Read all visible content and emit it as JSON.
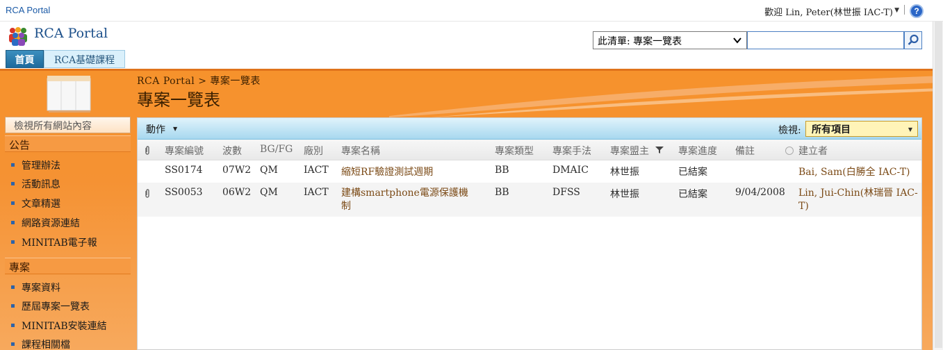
{
  "topbar": {
    "site_name": "RCA Portal",
    "welcome": "歡迎 Lin, Peter(林世振 IAC-T)",
    "help_icon": "help-icon"
  },
  "header": {
    "logo_text": "RCA Portal",
    "search_scope": "此清單: 專案一覽表",
    "search_placeholder": "",
    "tabs": [
      {
        "label": "首頁",
        "selected": true
      },
      {
        "label": "RCA基礎課程",
        "selected": false
      }
    ]
  },
  "page": {
    "breadcrumb": "RCA Portal > 專案一覽表",
    "title": "專案一覽表"
  },
  "leftnav": {
    "view_all": "檢視所有網站內容",
    "sections": [
      {
        "heading": "公告",
        "items": [
          "管理辦法",
          "活動訊息",
          "文章精選",
          "網路資源連結",
          "MINITAB電子報"
        ]
      },
      {
        "heading": "專案",
        "items": [
          "專案資料",
          "歷屆專案一覽表",
          "MINITAB安裝連結",
          "課程相關檔"
        ]
      }
    ]
  },
  "toolbar": {
    "actions": "動作",
    "view_label": "檢視:",
    "view_value": "所有項目"
  },
  "list": {
    "columns": [
      "專案編號",
      "波數",
      "BG/FG",
      "廠別",
      "專案名稱",
      "專案類型",
      "專案手法",
      "專案盟主",
      "專案進度",
      "備註",
      "建立者"
    ],
    "rows": [
      {
        "attachment": false,
        "id": "SS0174",
        "wave": "07W2",
        "bg": "QM",
        "plant": "IACT",
        "name": "縮短RF驗證測試週期",
        "type": "BB",
        "method": "DMAIC",
        "owner": "林世振",
        "progress": "已結案",
        "note": "",
        "creator": "Bai, Sam(白勝全 IAC-T)"
      },
      {
        "attachment": true,
        "id": "SS0053",
        "wave": "06W2",
        "bg": "QM",
        "plant": "IACT",
        "name": "建構smartphone電源保護機制",
        "type": "BB",
        "method": "DFSS",
        "owner": "林世振",
        "progress": "已結案",
        "note": "9/04/2008",
        "creator": "Lin, Jui-Chin(林瑞晉 IAC-T)"
      }
    ]
  },
  "colors": {
    "orange_band": "#f6922c",
    "toolbar_blue": "#a7d8ef",
    "link_brown": "#7b4a16",
    "tab_active": "#1e6a9c"
  }
}
